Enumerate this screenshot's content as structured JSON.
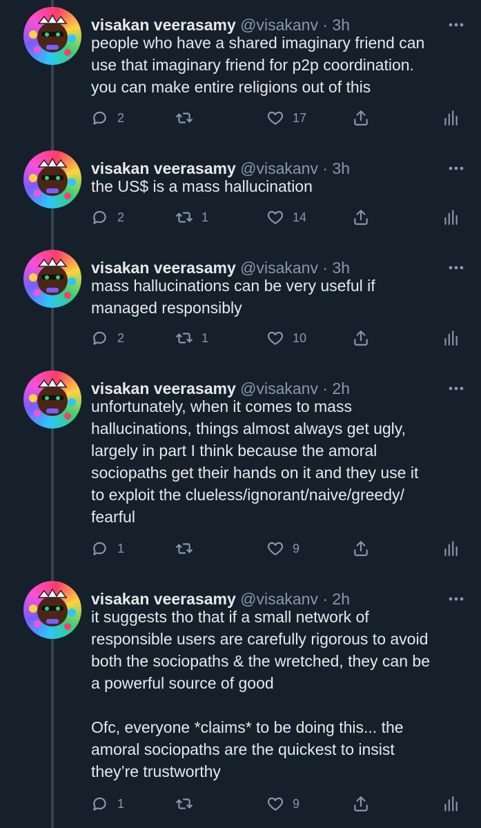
{
  "tweets": [
    {
      "name": "visakan veerasamy",
      "handle": "@visakanv",
      "dot": "·",
      "time": "3h",
      "paragraphs": [
        [
          "people who have a shared imaginary friend can",
          "use that imaginary friend for p2p coordination.",
          "you can make entire religions out of this"
        ]
      ],
      "replies": "2",
      "retweets": "",
      "likes": "17"
    },
    {
      "name": "visakan veerasamy",
      "handle": "@visakanv",
      "dot": "·",
      "time": "3h",
      "paragraphs": [
        [
          "the US$ is a mass hallucination"
        ]
      ],
      "replies": "2",
      "retweets": "1",
      "likes": "14"
    },
    {
      "name": "visakan veerasamy",
      "handle": "@visakanv",
      "dot": "·",
      "time": "3h",
      "paragraphs": [
        [
          "mass hallucinations can be very useful if",
          "managed responsibly"
        ]
      ],
      "replies": "2",
      "retweets": "1",
      "likes": "10"
    },
    {
      "name": "visakan veerasamy",
      "handle": "@visakanv",
      "dot": "·",
      "time": "2h",
      "paragraphs": [
        [
          "unfortunately, when it comes to mass",
          "hallucinations, things almost always get ugly,",
          "largely in part I think because the amoral",
          "sociopaths get their hands on it and they use it",
          "to exploit the clueless/ignorant/naive/greedy/",
          "fearful"
        ]
      ],
      "replies": "1",
      "retweets": "",
      "likes": "9"
    },
    {
      "name": "visakan veerasamy",
      "handle": "@visakanv",
      "dot": "·",
      "time": "2h",
      "paragraphs": [
        [
          "it suggests tho that if a small network of",
          "responsible users are carefully rigorous to avoid",
          "both the sociopaths & the wretched, they can be",
          "a powerful source of good"
        ],
        [
          "Ofc, everyone *claims* to be doing this... the",
          "amoral sociopaths are the quickest to insist",
          "they’re trustworthy"
        ]
      ],
      "replies": "1",
      "retweets": "",
      "likes": "9"
    }
  ],
  "icons": {
    "more": "more-dots-icon",
    "reply": "reply-bubble-icon",
    "retweet": "retweet-arrows-icon",
    "like": "heart-icon",
    "share": "share-upload-icon",
    "analytics": "analytics-bars-icon"
  },
  "colors": {
    "background": "#15202b",
    "text": "#e7e9ea",
    "secondary": "#8b98a5",
    "thread_line": "#38444d"
  }
}
